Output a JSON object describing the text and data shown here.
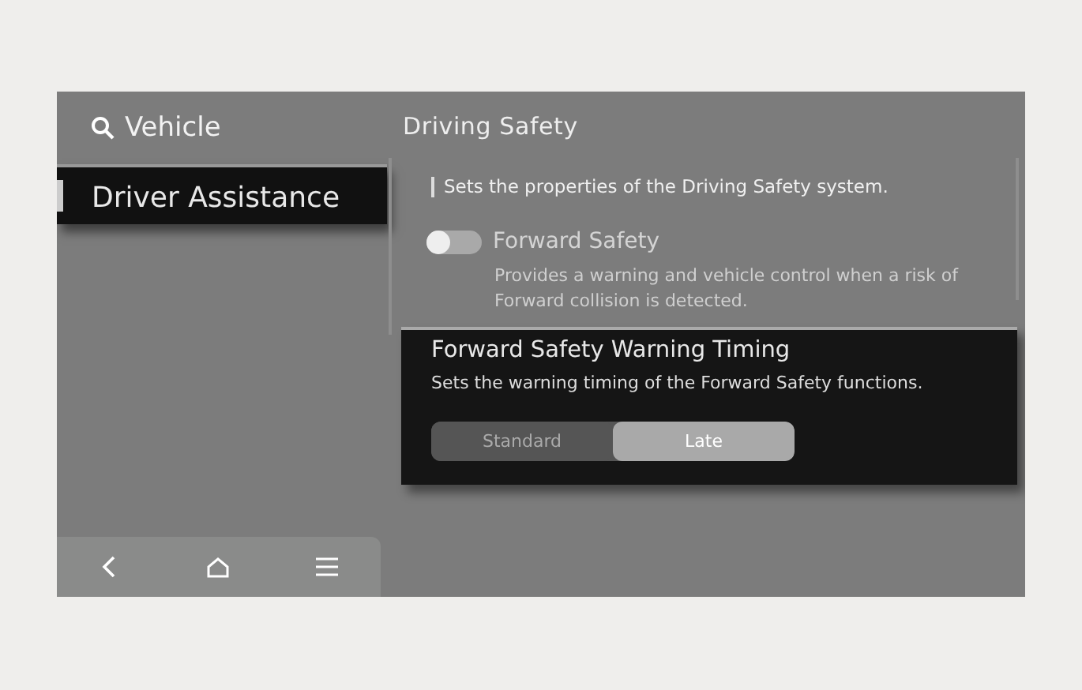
{
  "sidebar": {
    "search_label": "Vehicle",
    "items": [
      {
        "label": "Driver Assistance",
        "selected": true
      }
    ]
  },
  "nav_bar": {
    "buttons": [
      {
        "kind": "back"
      },
      {
        "kind": "home"
      },
      {
        "kind": "menu"
      }
    ]
  },
  "content": {
    "title": "Driving Safety",
    "description": "Sets the properties of the Driving Safety system.",
    "settings": [
      {
        "kind": "toggle",
        "label": "Forward Safety",
        "on": false,
        "description": "Provides a warning and vehicle control when a risk of Forward collision is detected."
      }
    ],
    "popup": {
      "title": "Forward Safety Warning Timing",
      "description": "Sets the warning timing of the Forward Safety functions.",
      "options": [
        {
          "label": "Standard",
          "selected": false
        },
        {
          "label": "Late",
          "selected": true
        }
      ]
    }
  }
}
